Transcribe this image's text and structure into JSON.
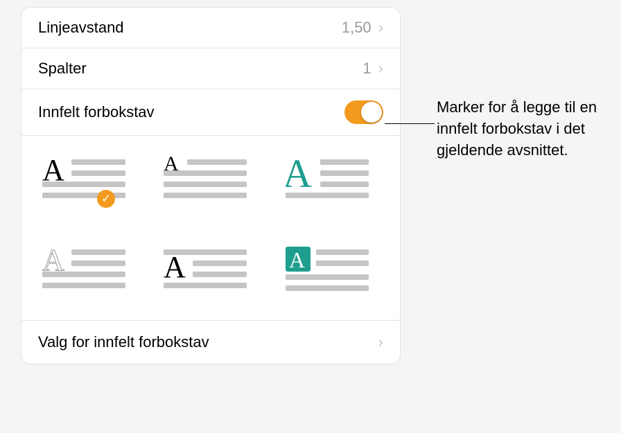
{
  "rows": {
    "lineSpacing": {
      "label": "Linjeavstand",
      "value": "1,50"
    },
    "columns": {
      "label": "Spalter",
      "value": "1"
    },
    "dropCap": {
      "label": "Innfelt forbokstav",
      "enabled": true
    },
    "options": {
      "label": "Valg for innfelt forbokstav"
    }
  },
  "styles": [
    {
      "id": "style-1",
      "selected": true
    },
    {
      "id": "style-2",
      "selected": false
    },
    {
      "id": "style-3",
      "selected": false
    },
    {
      "id": "style-4",
      "selected": false
    },
    {
      "id": "style-5",
      "selected": false
    },
    {
      "id": "style-6",
      "selected": false
    }
  ],
  "callout": "Marker for å legge til en innfelt forbokstav i det gjeldende avsnittet.",
  "glyphs": {
    "chevron": "›",
    "check": "✓"
  }
}
